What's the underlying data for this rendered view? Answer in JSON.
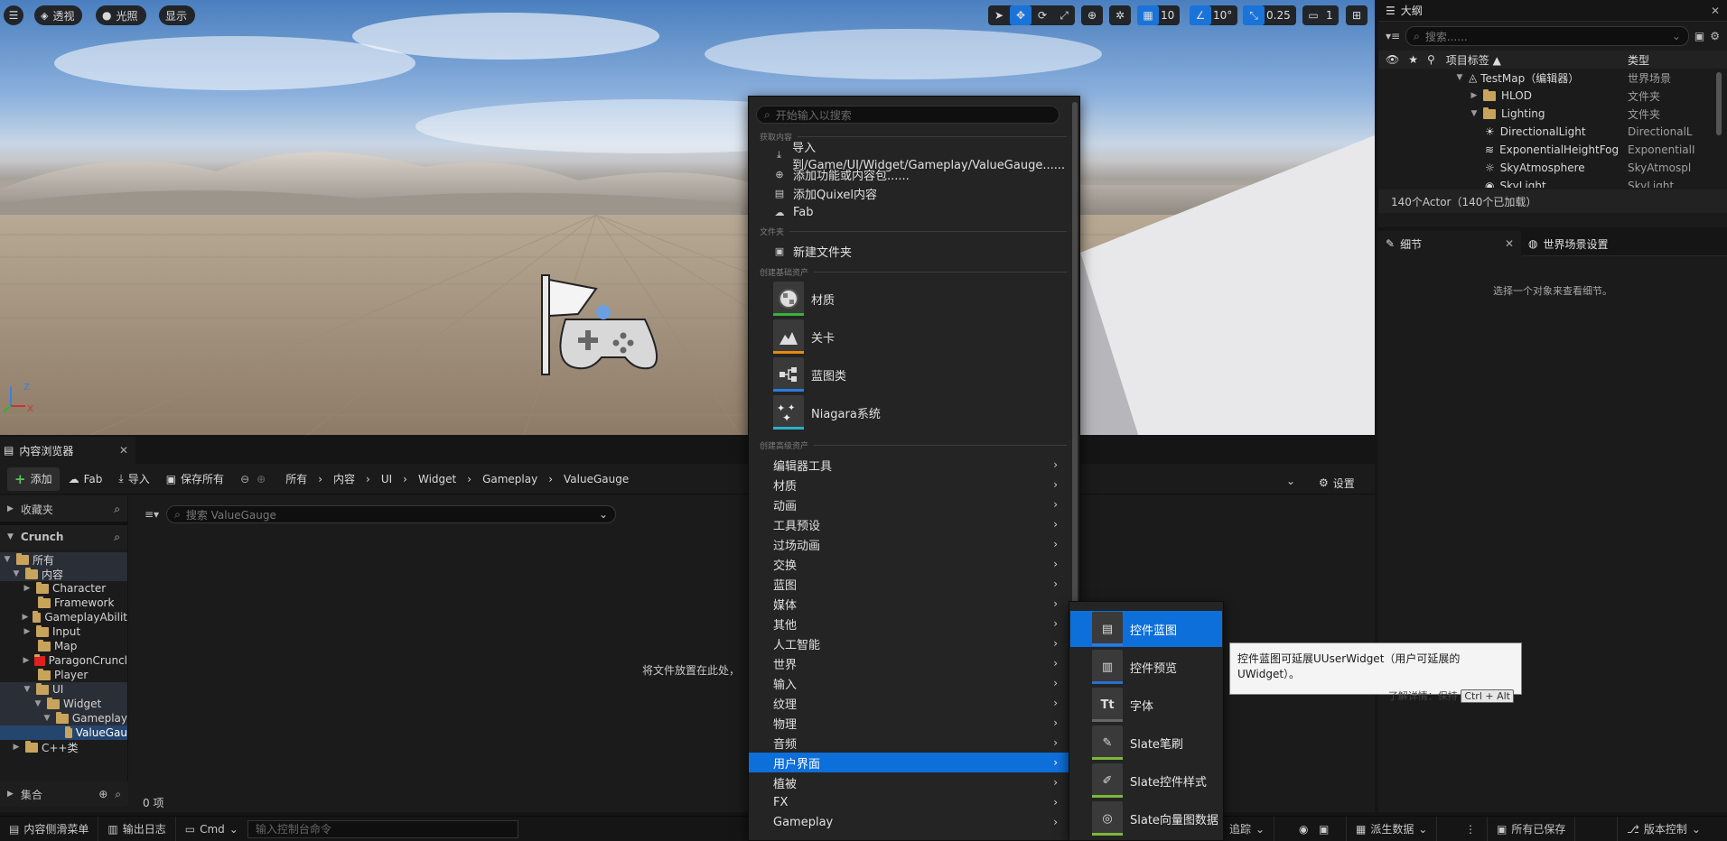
{
  "viewport": {
    "menu_icon": "hamburger-icon",
    "view_mode": "透视",
    "lighting": "光照",
    "show": "显示",
    "grid_snap": "10",
    "rotation_snap": "10°",
    "scale_snap": "0.25",
    "camera_speed": "1"
  },
  "outliner": {
    "tab_title": "大纲",
    "search_placeholder": "搜索......",
    "col_label": "项目标签 ▲",
    "col_type": "类型",
    "rows": [
      {
        "label": "TestMap（编辑器）",
        "type": "世界场景"
      },
      {
        "label": "HLOD",
        "type": "文件夹"
      },
      {
        "label": "Lighting",
        "type": "文件夹"
      },
      {
        "label": "DirectionalLight",
        "type": "DirectionalL"
      },
      {
        "label": "ExponentialHeightFog",
        "type": "ExponentialI"
      },
      {
        "label": "SkyAtmosphere",
        "type": "SkyAtmospl"
      },
      {
        "label": "SkyLight",
        "type": "SkyLight"
      }
    ],
    "footer": "140个Actor（140个已加载）"
  },
  "details": {
    "tab_details": "细节",
    "tab_world": "世界场景设置",
    "empty_msg": "选择一个对象来查看细节。"
  },
  "content_browser": {
    "tab_title": "内容浏览器",
    "add": "添加",
    "fab": "Fab",
    "import": "导入",
    "save_all": "保存所有",
    "breadcrumb": [
      "所有",
      "内容",
      "UI",
      "Widget",
      "Gameplay",
      "ValueGauge"
    ],
    "settings": "设置",
    "favorites": "收藏夹",
    "project": "Crunch",
    "search_placeholder": "搜索 ValueGauge",
    "tree": [
      "所有",
      "内容",
      "Character",
      "Framework",
      "GameplayAbilit",
      "Input",
      "Map",
      "ParagonCruncl",
      "Player",
      "UI",
      "Widget",
      "Gameplay",
      "ValueGau",
      "C++类"
    ],
    "collections": "集合",
    "drop_hint": "将文件放置在此处，",
    "item_count": "0 项"
  },
  "statusbar": {
    "drawer": "内容侧滑菜单",
    "output_log": "输出日志",
    "cmd": "Cmd",
    "cmd_placeholder": "输入控制台命令",
    "trace": "追踪",
    "derived_data": "派生数据",
    "all_saved": "所有已保存",
    "source_control": "版本控制"
  },
  "menu": {
    "search_placeholder": "开始输入以搜索",
    "section_get": "获取内容",
    "import_to": "导入到/Game/UI/Widget/Gameplay/ValueGauge......",
    "add_feature": "添加功能或内容包......",
    "add_quixel": "添加Quixel内容",
    "fab": "Fab",
    "section_folder": "文件夹",
    "new_folder": "新建文件夹",
    "section_basic": "创建基础资产",
    "basic_assets": [
      "材质",
      "关卡",
      "蓝图类",
      "Niagara系统"
    ],
    "section_advanced": "创建高级资产",
    "categories": [
      "编辑器工具",
      "材质",
      "动画",
      "工具预设",
      "过场动画",
      "交换",
      "蓝图",
      "媒体",
      "其他",
      "人工智能",
      "世界",
      "输入",
      "纹理",
      "物理",
      "音频",
      "用户界面",
      "植被",
      "FX",
      "Gameplay"
    ]
  },
  "submenu": {
    "items": [
      "控件蓝图",
      "控件预览",
      "字体",
      "Slate笔刷",
      "Slate控件样式",
      "Slate向量图数据"
    ]
  },
  "tooltip": {
    "text": "控件蓝图可延展UUserWidget（用户可延展的UWidget）。",
    "more": "了解详情：保持",
    "shortcut": "Ctrl + Alt"
  },
  "colors": {
    "accent": "#0d6fd9",
    "menu_bg": "#242424",
    "panel_bg": "#1b1b1b",
    "folder": "#c8a35b"
  }
}
